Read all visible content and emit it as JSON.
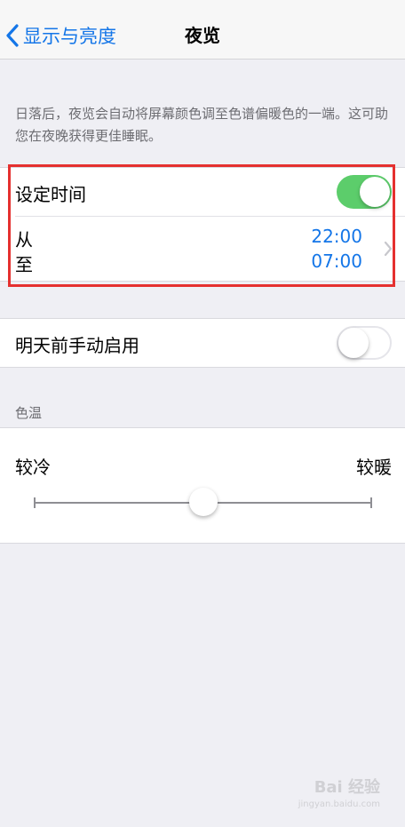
{
  "navbar": {
    "back_label": "显示与亮度",
    "title": "夜览"
  },
  "description": "日落后，夜览会自动将屏幕颜色调至色谱偏暖色的一端。这可助您在夜晚获得更佳睡眠。",
  "schedule": {
    "label": "设定时间",
    "enabled": true,
    "from_label": "从",
    "to_label": "至",
    "from_time": "22:00",
    "to_time": "07:00"
  },
  "manual": {
    "label": "明天前手动启用",
    "enabled": false
  },
  "color_temperature": {
    "header": "色温",
    "cool_label": "较冷",
    "warm_label": "较暖",
    "level": 0.5
  },
  "watermark": {
    "text": "Bai 经验",
    "sub": "jingyan.baidu.com"
  },
  "colors": {
    "accent": "#1476e8",
    "toggle_on": "#5ccd6b",
    "highlight": "#e5302f"
  }
}
